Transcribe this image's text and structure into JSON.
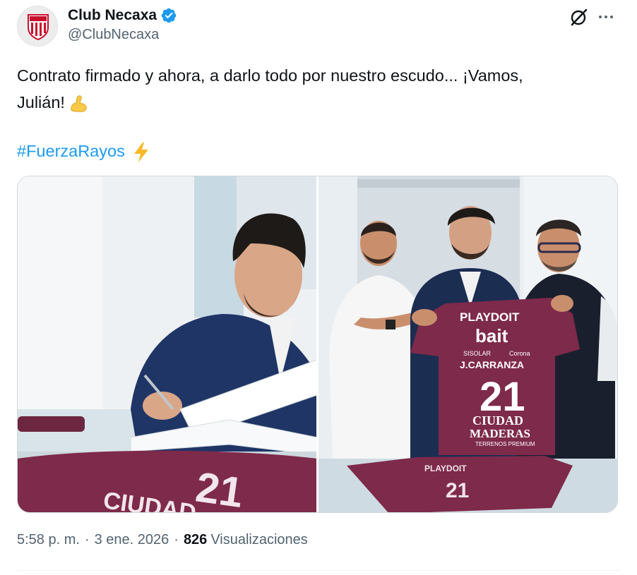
{
  "author": {
    "display_name": "Club Necaxa",
    "handle": "@ClubNecaxa",
    "verified_color": "#1d9bf0",
    "avatar_icon": "necaxa-crest-icon"
  },
  "actions": {
    "grok_icon": "grok-icon",
    "more_icon": "more-options-icon"
  },
  "tweet": {
    "text_line1": "Contrato firmado y ahora, a darlo todo por nuestro escudo... ¡Vamos,",
    "text_line2": "Julián!",
    "emoji1": "flexed-biceps-emoji",
    "hashtag": "#FuerzaRayos",
    "emoji2": "high-voltage-emoji"
  },
  "media": {
    "photos": [
      {
        "description_icon": "photo-signing-contract"
      },
      {
        "description_icon": "photo-jersey-presentation"
      }
    ],
    "jersey": {
      "sponsor_top": "PLAYDOIT",
      "sponsor_main": "bait",
      "sponsor_small_left": "SISOLAR",
      "sponsor_small_right": "Corona",
      "player_name": "J.CARRANZA",
      "number": "21",
      "sponsor_bottom_1": "CIUDAD",
      "sponsor_bottom_2": "MADERAS",
      "sponsor_bottom_3": "TERRENOS PREMIUM",
      "jersey_color": "#7e2a4a"
    }
  },
  "meta": {
    "time": "5:58 p. m.",
    "separator": "·",
    "date": "3 ene. 2026",
    "views_count": "826",
    "views_label": "Visualizaciones"
  }
}
